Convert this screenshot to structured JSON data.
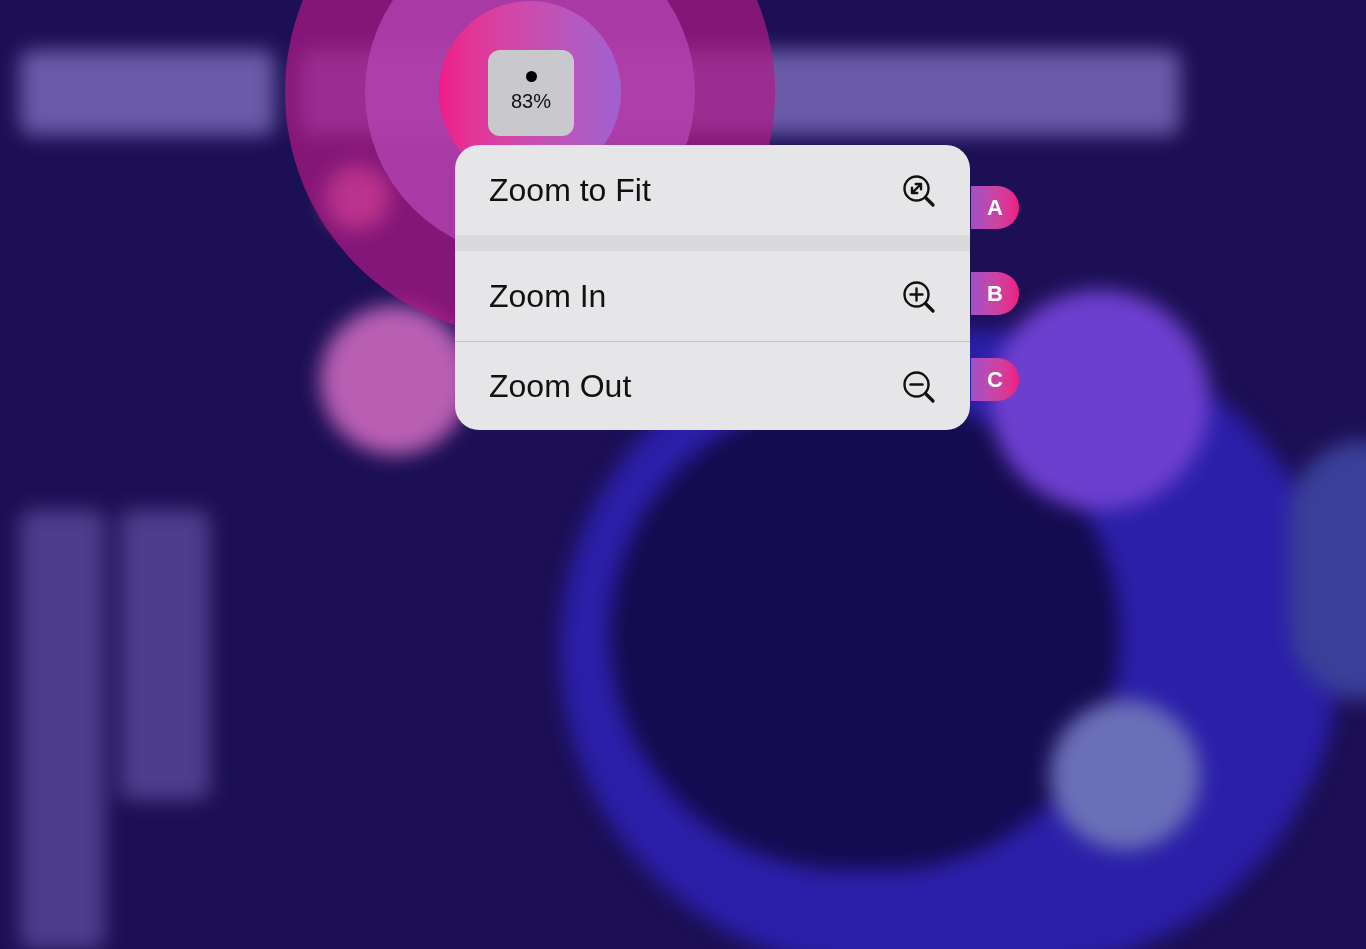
{
  "zoom_button": {
    "label": "83%"
  },
  "menu": {
    "sections": [
      [
        {
          "label": "Zoom to Fit",
          "kind": "fit",
          "badge": "A"
        }
      ],
      [
        {
          "label": "Zoom In",
          "kind": "in",
          "badge": "B"
        },
        {
          "label": "Zoom Out",
          "kind": "out",
          "badge": "C"
        }
      ]
    ]
  }
}
